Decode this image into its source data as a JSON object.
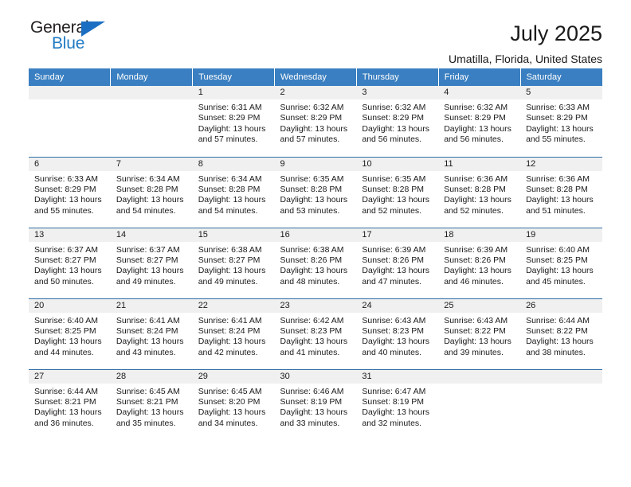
{
  "brand": {
    "name_part1": "General",
    "name_part2": "Blue",
    "triangle_icon": "triangle-icon",
    "accent_color": "#1b6ec2"
  },
  "header": {
    "title": "July 2025",
    "subtitle": "Umatilla, Florida, United States"
  },
  "calendar": {
    "header_bg": "#3a7fc1",
    "row_divider": "#2e6da4",
    "daynum_bg": "#f0f0f0",
    "weekdays": [
      "Sunday",
      "Monday",
      "Tuesday",
      "Wednesday",
      "Thursday",
      "Friday",
      "Saturday"
    ],
    "labels": {
      "sunrise": "Sunrise:",
      "sunset": "Sunset:",
      "daylight": "Daylight:"
    },
    "weeks": [
      [
        {
          "day": ""
        },
        {
          "day": ""
        },
        {
          "day": "1",
          "sunrise": "Sunrise: 6:31 AM",
          "sunset": "Sunset: 8:29 PM",
          "daylight": "Daylight: 13 hours and 57 minutes."
        },
        {
          "day": "2",
          "sunrise": "Sunrise: 6:32 AM",
          "sunset": "Sunset: 8:29 PM",
          "daylight": "Daylight: 13 hours and 57 minutes."
        },
        {
          "day": "3",
          "sunrise": "Sunrise: 6:32 AM",
          "sunset": "Sunset: 8:29 PM",
          "daylight": "Daylight: 13 hours and 56 minutes."
        },
        {
          "day": "4",
          "sunrise": "Sunrise: 6:32 AM",
          "sunset": "Sunset: 8:29 PM",
          "daylight": "Daylight: 13 hours and 56 minutes."
        },
        {
          "day": "5",
          "sunrise": "Sunrise: 6:33 AM",
          "sunset": "Sunset: 8:29 PM",
          "daylight": "Daylight: 13 hours and 55 minutes."
        }
      ],
      [
        {
          "day": "6",
          "sunrise": "Sunrise: 6:33 AM",
          "sunset": "Sunset: 8:29 PM",
          "daylight": "Daylight: 13 hours and 55 minutes."
        },
        {
          "day": "7",
          "sunrise": "Sunrise: 6:34 AM",
          "sunset": "Sunset: 8:28 PM",
          "daylight": "Daylight: 13 hours and 54 minutes."
        },
        {
          "day": "8",
          "sunrise": "Sunrise: 6:34 AM",
          "sunset": "Sunset: 8:28 PM",
          "daylight": "Daylight: 13 hours and 54 minutes."
        },
        {
          "day": "9",
          "sunrise": "Sunrise: 6:35 AM",
          "sunset": "Sunset: 8:28 PM",
          "daylight": "Daylight: 13 hours and 53 minutes."
        },
        {
          "day": "10",
          "sunrise": "Sunrise: 6:35 AM",
          "sunset": "Sunset: 8:28 PM",
          "daylight": "Daylight: 13 hours and 52 minutes."
        },
        {
          "day": "11",
          "sunrise": "Sunrise: 6:36 AM",
          "sunset": "Sunset: 8:28 PM",
          "daylight": "Daylight: 13 hours and 52 minutes."
        },
        {
          "day": "12",
          "sunrise": "Sunrise: 6:36 AM",
          "sunset": "Sunset: 8:28 PM",
          "daylight": "Daylight: 13 hours and 51 minutes."
        }
      ],
      [
        {
          "day": "13",
          "sunrise": "Sunrise: 6:37 AM",
          "sunset": "Sunset: 8:27 PM",
          "daylight": "Daylight: 13 hours and 50 minutes."
        },
        {
          "day": "14",
          "sunrise": "Sunrise: 6:37 AM",
          "sunset": "Sunset: 8:27 PM",
          "daylight": "Daylight: 13 hours and 49 minutes."
        },
        {
          "day": "15",
          "sunrise": "Sunrise: 6:38 AM",
          "sunset": "Sunset: 8:27 PM",
          "daylight": "Daylight: 13 hours and 49 minutes."
        },
        {
          "day": "16",
          "sunrise": "Sunrise: 6:38 AM",
          "sunset": "Sunset: 8:26 PM",
          "daylight": "Daylight: 13 hours and 48 minutes."
        },
        {
          "day": "17",
          "sunrise": "Sunrise: 6:39 AM",
          "sunset": "Sunset: 8:26 PM",
          "daylight": "Daylight: 13 hours and 47 minutes."
        },
        {
          "day": "18",
          "sunrise": "Sunrise: 6:39 AM",
          "sunset": "Sunset: 8:26 PM",
          "daylight": "Daylight: 13 hours and 46 minutes."
        },
        {
          "day": "19",
          "sunrise": "Sunrise: 6:40 AM",
          "sunset": "Sunset: 8:25 PM",
          "daylight": "Daylight: 13 hours and 45 minutes."
        }
      ],
      [
        {
          "day": "20",
          "sunrise": "Sunrise: 6:40 AM",
          "sunset": "Sunset: 8:25 PM",
          "daylight": "Daylight: 13 hours and 44 minutes."
        },
        {
          "day": "21",
          "sunrise": "Sunrise: 6:41 AM",
          "sunset": "Sunset: 8:24 PM",
          "daylight": "Daylight: 13 hours and 43 minutes."
        },
        {
          "day": "22",
          "sunrise": "Sunrise: 6:41 AM",
          "sunset": "Sunset: 8:24 PM",
          "daylight": "Daylight: 13 hours and 42 minutes."
        },
        {
          "day": "23",
          "sunrise": "Sunrise: 6:42 AM",
          "sunset": "Sunset: 8:23 PM",
          "daylight": "Daylight: 13 hours and 41 minutes."
        },
        {
          "day": "24",
          "sunrise": "Sunrise: 6:43 AM",
          "sunset": "Sunset: 8:23 PM",
          "daylight": "Daylight: 13 hours and 40 minutes."
        },
        {
          "day": "25",
          "sunrise": "Sunrise: 6:43 AM",
          "sunset": "Sunset: 8:22 PM",
          "daylight": "Daylight: 13 hours and 39 minutes."
        },
        {
          "day": "26",
          "sunrise": "Sunrise: 6:44 AM",
          "sunset": "Sunset: 8:22 PM",
          "daylight": "Daylight: 13 hours and 38 minutes."
        }
      ],
      [
        {
          "day": "27",
          "sunrise": "Sunrise: 6:44 AM",
          "sunset": "Sunset: 8:21 PM",
          "daylight": "Daylight: 13 hours and 36 minutes."
        },
        {
          "day": "28",
          "sunrise": "Sunrise: 6:45 AM",
          "sunset": "Sunset: 8:21 PM",
          "daylight": "Daylight: 13 hours and 35 minutes."
        },
        {
          "day": "29",
          "sunrise": "Sunrise: 6:45 AM",
          "sunset": "Sunset: 8:20 PM",
          "daylight": "Daylight: 13 hours and 34 minutes."
        },
        {
          "day": "30",
          "sunrise": "Sunrise: 6:46 AM",
          "sunset": "Sunset: 8:19 PM",
          "daylight": "Daylight: 13 hours and 33 minutes."
        },
        {
          "day": "31",
          "sunrise": "Sunrise: 6:47 AM",
          "sunset": "Sunset: 8:19 PM",
          "daylight": "Daylight: 13 hours and 32 minutes."
        },
        {
          "day": ""
        },
        {
          "day": ""
        }
      ]
    ]
  }
}
